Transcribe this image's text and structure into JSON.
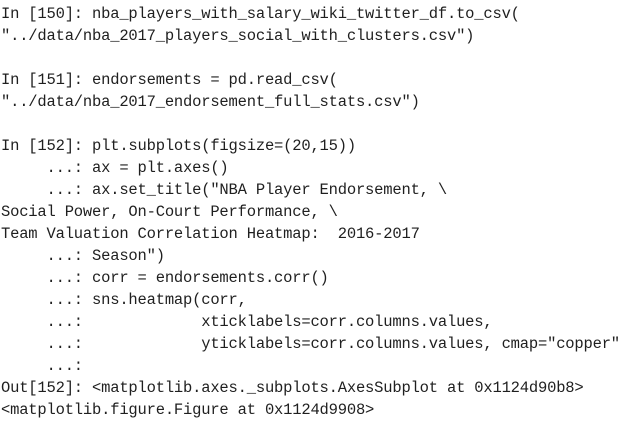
{
  "console": {
    "cell150": {
      "line1": "In [150]: nba_players_with_salary_wiki_twitter_df.to_csv(",
      "line2": "\"../data/nba_2017_players_social_with_clusters.csv\")"
    },
    "cell151": {
      "line1": "In [151]: endorsements = pd.read_csv(",
      "line2": "\"../data/nba_2017_endorsement_full_stats.csv\")"
    },
    "cell152": {
      "line1": "In [152]: plt.subplots(figsize=(20,15))",
      "line2": "     ...: ax = plt.axes()",
      "line3": "     ...: ax.set_title(\"NBA Player Endorsement, \\",
      "line4": "Social Power, On-Court Performance, \\",
      "line5": "Team Valuation Correlation Heatmap:  2016-2017",
      "line6": "     ...: Season\")",
      "line7": "     ...: corr = endorsements.corr()",
      "line8": "     ...: sns.heatmap(corr,",
      "line9": "     ...:             xticklabels=corr.columns.values,",
      "line10": "     ...:             yticklabels=corr.columns.values, cmap=\"copper\")",
      "line11": "     ...:",
      "out1": "Out[152]: <matplotlib.axes._subplots.AxesSubplot at 0x1124d90b8>",
      "out2": "<matplotlib.figure.Figure at 0x1124d9908>"
    }
  }
}
